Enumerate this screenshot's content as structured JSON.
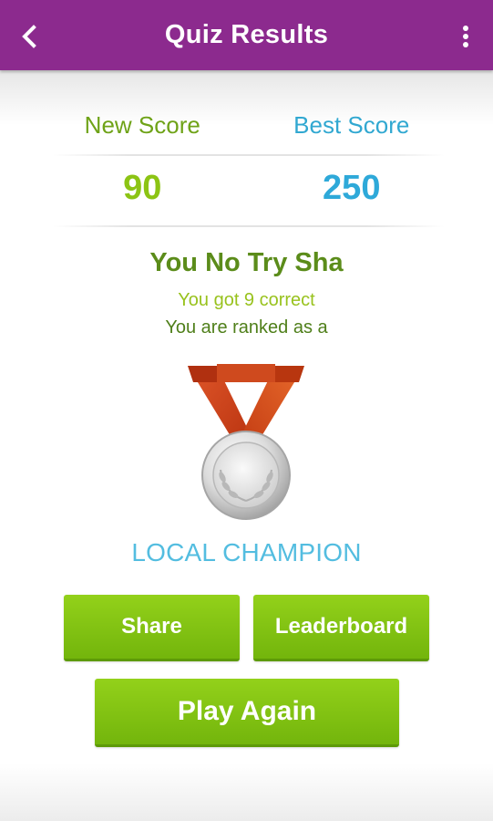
{
  "app_bar": {
    "title": "Quiz Results",
    "back_icon": "chevron-left-icon",
    "menu_icon": "more-vertical-icon",
    "color": "#8c2a8e"
  },
  "scores": {
    "new_label": "New Score",
    "best_label": "Best Score",
    "new_value": "90",
    "best_value": "250"
  },
  "result": {
    "headline": "You No Try Sha",
    "correct_text": "You got 9 correct",
    "ranked_text": "You are ranked as a",
    "medal_icon": "silver-medal-icon",
    "rank": "LOCAL CHAMPION"
  },
  "buttons": {
    "share": "Share",
    "leaderboard": "Leaderboard",
    "play_again": "Play Again"
  },
  "colors": {
    "button_green": "#83c314",
    "new_score": "#8cc414",
    "best_score": "#2ea9d9",
    "rank": "#53bde0"
  }
}
